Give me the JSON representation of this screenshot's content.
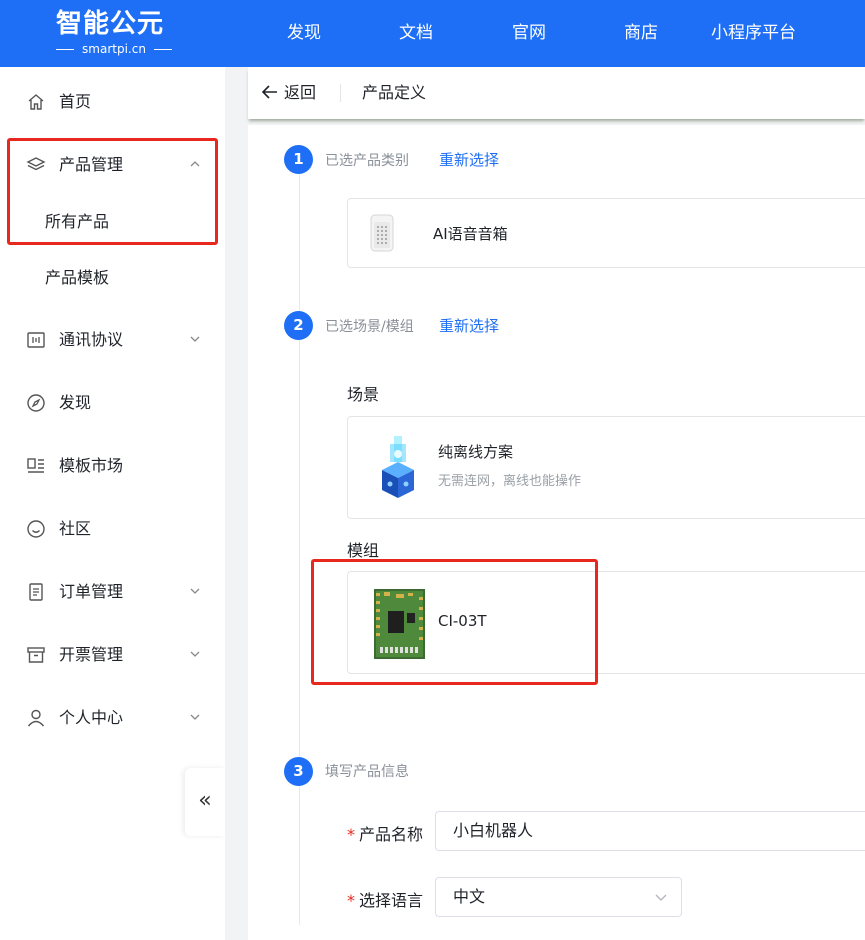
{
  "brand": {
    "name": "智能公元",
    "domain": "smartpi.cn"
  },
  "nav": [
    "发现",
    "文档",
    "官网",
    "商店",
    "小程序平台"
  ],
  "sidebar": {
    "items": [
      {
        "label": "首页",
        "icon": "home-icon"
      },
      {
        "label": "产品管理",
        "icon": "layers-icon",
        "expanded": true,
        "sub": [
          "所有产品",
          "产品模板"
        ]
      },
      {
        "label": "通讯协议",
        "icon": "protocol-icon"
      },
      {
        "label": "发现",
        "icon": "compass-icon"
      },
      {
        "label": "模板市场",
        "icon": "template-market-icon"
      },
      {
        "label": "社区",
        "icon": "smile-icon"
      },
      {
        "label": "订单管理",
        "icon": "document-icon"
      },
      {
        "label": "开票管理",
        "icon": "archive-icon"
      },
      {
        "label": "个人中心",
        "icon": "user-icon"
      }
    ],
    "collapse_glyph": "«"
  },
  "header": {
    "back_label": "返回",
    "title": "产品定义"
  },
  "steps": [
    {
      "num": "1",
      "label": "已选产品类别",
      "link": "重新选择"
    },
    {
      "num": "2",
      "label": "已选场景/模组",
      "link": "重新选择"
    },
    {
      "num": "3",
      "label": "填写产品信息"
    }
  ],
  "category": {
    "name": "AI语音音箱"
  },
  "scene": {
    "section_title": "场景",
    "name": "纯离线方案",
    "desc": "无需连网，离线也能操作"
  },
  "module": {
    "section_title": "模组",
    "name": "CI-03T"
  },
  "form": {
    "name_label": "产品名称",
    "name_value": "小白机器人",
    "lang_label": "选择语言",
    "lang_value": "中文",
    "required_mark": "*"
  },
  "colors": {
    "primary": "#1e6ff5",
    "highlight": "#e8281f"
  }
}
